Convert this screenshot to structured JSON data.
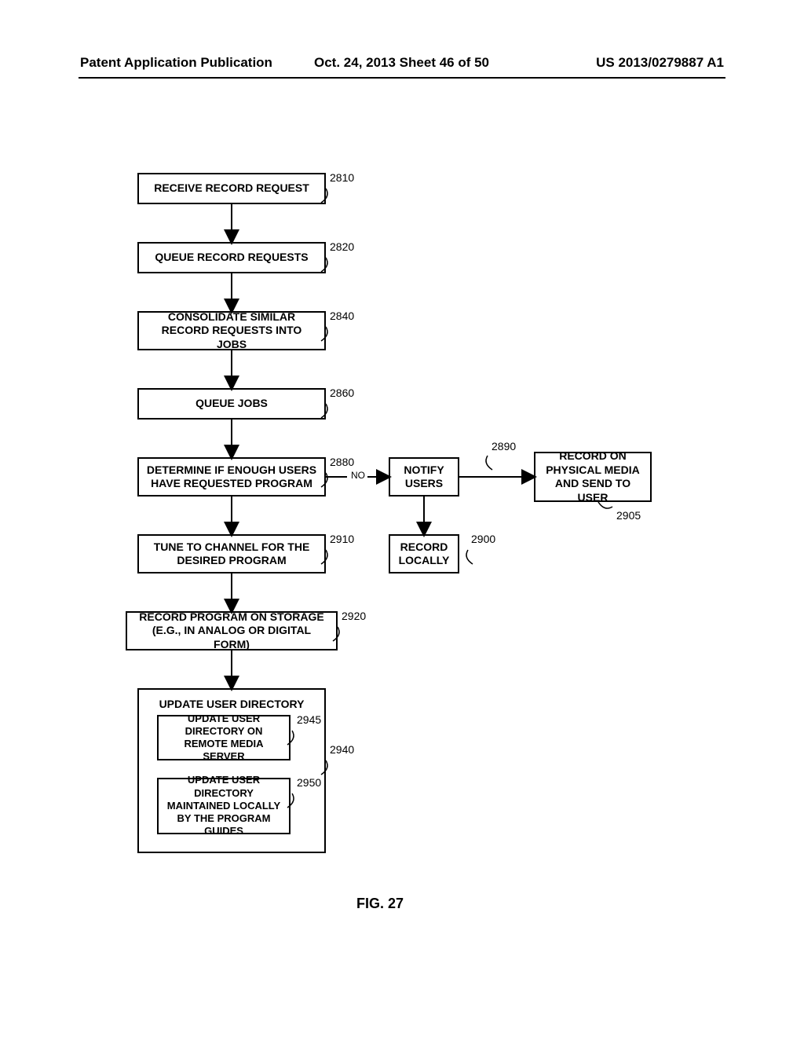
{
  "header": {
    "left": "Patent Application Publication",
    "mid": "Oct. 24, 2013  Sheet 46 of 50",
    "right": "US 2013/0279887 A1"
  },
  "boxes": {
    "b2810": "RECEIVE RECORD REQUEST",
    "b2820": "QUEUE RECORD REQUESTS",
    "b2840": "CONSOLIDATE SIMILAR RECORD REQUESTS INTO JOBS",
    "b2860": "QUEUE JOBS",
    "b2880": "DETERMINE IF ENOUGH USERS HAVE REQUESTED PROGRAM",
    "b2890": "NOTIFY USERS",
    "b2905": "RECORD ON PHYSICAL MEDIA AND SEND TO USER",
    "b2900": "RECORD LOCALLY",
    "b2910": "TUNE TO CHANNEL FOR THE DESIRED PROGRAM",
    "b2920": "RECORD PROGRAM ON STORAGE (E.G., IN ANALOG OR DIGITAL FORM)",
    "b2940_title": "UPDATE USER DIRECTORY",
    "b2945": "UPDATE USER DIRECTORY ON REMOTE MEDIA SERVER",
    "b2950": "UPDATE USER DIRECTORY MAINTAINED LOCALLY BY THE PROGRAM GUIDES"
  },
  "refs": {
    "r2810": "2810",
    "r2820": "2820",
    "r2840": "2840",
    "r2860": "2860",
    "r2880": "2880",
    "r2890": "2890",
    "r2900": "2900",
    "r2905": "2905",
    "r2910": "2910",
    "r2920": "2920",
    "r2940": "2940",
    "r2945": "2945",
    "r2950": "2950"
  },
  "labels": {
    "no": "NO"
  },
  "figure": "FIG. 27",
  "chart_data": {
    "type": "flowchart",
    "title": "FIG. 27",
    "nodes": [
      {
        "id": "2810",
        "text": "RECEIVE RECORD REQUEST"
      },
      {
        "id": "2820",
        "text": "QUEUE RECORD REQUESTS"
      },
      {
        "id": "2840",
        "text": "CONSOLIDATE SIMILAR RECORD REQUESTS INTO JOBS"
      },
      {
        "id": "2860",
        "text": "QUEUE JOBS"
      },
      {
        "id": "2880",
        "text": "DETERMINE IF ENOUGH USERS HAVE REQUESTED PROGRAM",
        "type": "decision"
      },
      {
        "id": "2890",
        "text": "NOTIFY USERS"
      },
      {
        "id": "2905",
        "text": "RECORD ON PHYSICAL MEDIA AND SEND TO USER"
      },
      {
        "id": "2900",
        "text": "RECORD LOCALLY"
      },
      {
        "id": "2910",
        "text": "TUNE TO CHANNEL FOR THE DESIRED PROGRAM"
      },
      {
        "id": "2920",
        "text": "RECORD PROGRAM ON STORAGE (E.G., IN ANALOG OR DIGITAL FORM)"
      },
      {
        "id": "2940",
        "text": "UPDATE USER DIRECTORY",
        "type": "group",
        "children": [
          "2945",
          "2950"
        ]
      },
      {
        "id": "2945",
        "text": "UPDATE USER DIRECTORY ON REMOTE MEDIA SERVER"
      },
      {
        "id": "2950",
        "text": "UPDATE USER DIRECTORY MAINTAINED LOCALLY BY THE PROGRAM GUIDES"
      }
    ],
    "edges": [
      {
        "from": "2810",
        "to": "2820"
      },
      {
        "from": "2820",
        "to": "2840"
      },
      {
        "from": "2840",
        "to": "2860"
      },
      {
        "from": "2860",
        "to": "2880"
      },
      {
        "from": "2880",
        "to": "2910"
      },
      {
        "from": "2880",
        "to": "2890",
        "label": "NO"
      },
      {
        "from": "2890",
        "to": "2905"
      },
      {
        "from": "2890",
        "to": "2900"
      },
      {
        "from": "2910",
        "to": "2920"
      },
      {
        "from": "2920",
        "to": "2940"
      }
    ]
  }
}
